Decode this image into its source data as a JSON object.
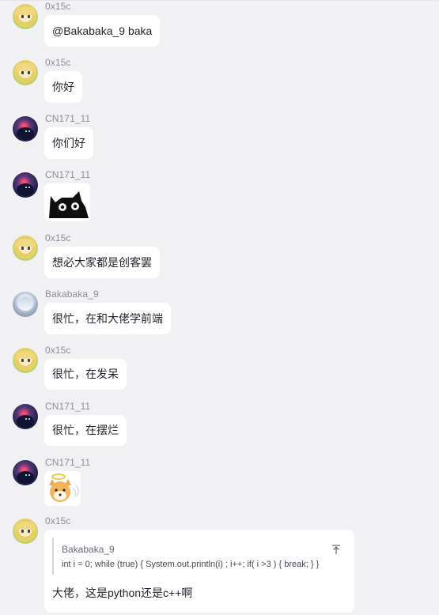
{
  "messages": [
    {
      "sender": "0x15c",
      "avatar": "anime-girl-avatar",
      "text": "@Bakabaka_9 baka"
    },
    {
      "sender": "0x15c",
      "avatar": "anime-girl-avatar",
      "text": "你好"
    },
    {
      "sender": "CN171_11",
      "avatar": "space-avatar",
      "text": "你们好"
    },
    {
      "sender": "CN171_11",
      "avatar": "space-avatar",
      "sticker": "black-cat-sticker"
    },
    {
      "sender": "0x15c",
      "avatar": "anime-girl-avatar",
      "text": "想必大家都是创客罢"
    },
    {
      "sender": "Bakabaka_9",
      "avatar": "anime-character-avatar",
      "text": "很忙，在和大佬学前端"
    },
    {
      "sender": "0x15c",
      "avatar": "anime-girl-avatar",
      "text": "很忙，在发呆"
    },
    {
      "sender": "CN171_11",
      "avatar": "space-avatar",
      "text": "很忙，在摆烂"
    },
    {
      "sender": "CN171_11",
      "avatar": "space-avatar",
      "sticker": "angel-dog-sticker"
    },
    {
      "sender": "0x15c",
      "avatar": "anime-girl-avatar",
      "quote": {
        "author": "Bakabaka_9",
        "text": "int i = 0; while (true) { System.out.println(i) ; i++; if( i >3 ) { break; } }",
        "icon": "collapse-arrow-icon"
      },
      "text": "大佬，这是python还是c++啊"
    }
  ],
  "colors": {
    "background": "#f1f1f3",
    "bubble": "#ffffff",
    "name": "#8b8f99",
    "text": "#1f2329"
  }
}
